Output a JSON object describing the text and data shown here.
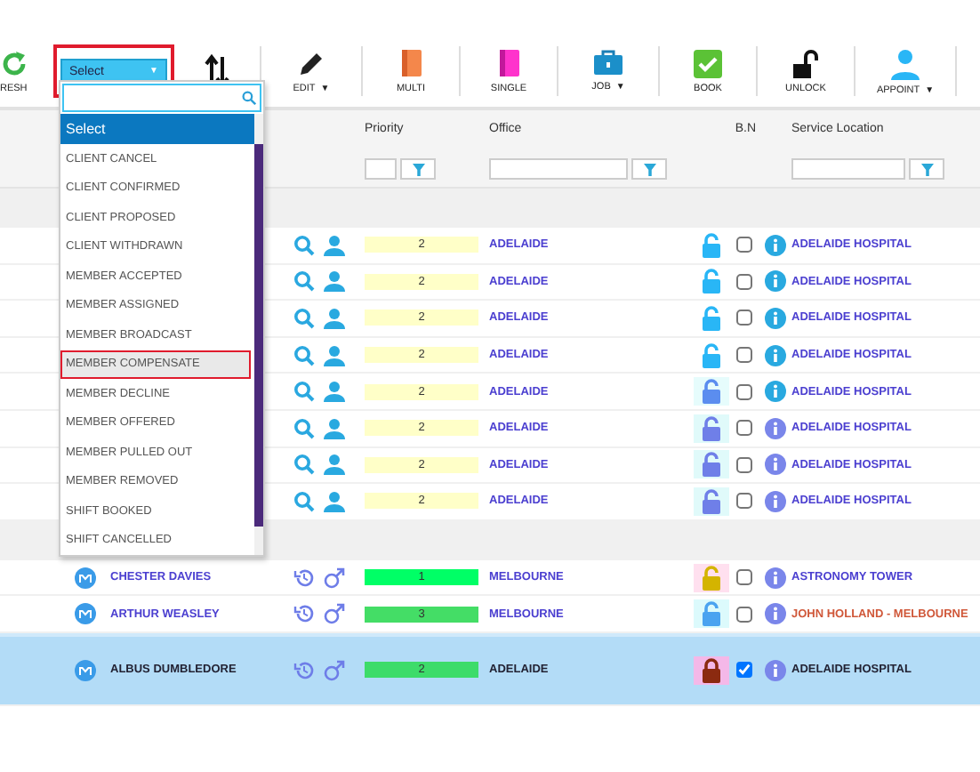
{
  "toolbar": {
    "buttons": [
      {
        "kind": "refresh",
        "label": "RESH"
      },
      {
        "kind": "select",
        "label": "Select",
        "caret": "▼",
        "highlighted": true
      },
      {
        "kind": "sort"
      },
      {
        "kind": "edit",
        "label": "EDIT",
        "caret": "▼"
      },
      {
        "kind": "multi",
        "label": "MULTI"
      },
      {
        "kind": "single",
        "label": "SINGLE"
      },
      {
        "kind": "job",
        "label": "JOB",
        "caret": "▼"
      },
      {
        "kind": "book",
        "label": "BOOK"
      },
      {
        "kind": "unlock",
        "label": "UNLOCK"
      },
      {
        "kind": "appoint",
        "label": "APPOINT",
        "caret": "▼"
      }
    ]
  },
  "dropdown": {
    "open": true,
    "options": [
      {
        "label": "Select",
        "selected": true,
        "hovered": false,
        "highlighted": false
      },
      {
        "label": "CLIENT CANCEL",
        "selected": false,
        "hovered": false,
        "highlighted": false
      },
      {
        "label": "CLIENT CONFIRMED",
        "selected": false,
        "hovered": false,
        "highlighted": false
      },
      {
        "label": "CLIENT PROPOSED",
        "selected": false,
        "hovered": false,
        "highlighted": false
      },
      {
        "label": "CLIENT WITHDRAWN",
        "selected": false,
        "hovered": false,
        "highlighted": false
      },
      {
        "label": "MEMBER ACCEPTED",
        "selected": false,
        "hovered": false,
        "highlighted": false
      },
      {
        "label": "MEMBER ASSIGNED",
        "selected": false,
        "hovered": false,
        "highlighted": false
      },
      {
        "label": "MEMBER BROADCAST",
        "selected": false,
        "hovered": false,
        "highlighted": false
      },
      {
        "label": "MEMBER COMPENSATE",
        "selected": false,
        "hovered": true,
        "highlighted": true
      },
      {
        "label": "MEMBER DECLINE",
        "selected": false,
        "hovered": false,
        "highlighted": false
      },
      {
        "label": "MEMBER OFFERED",
        "selected": false,
        "hovered": false,
        "highlighted": false
      },
      {
        "label": "MEMBER PULLED OUT",
        "selected": false,
        "hovered": false,
        "highlighted": false
      },
      {
        "label": "MEMBER REMOVED",
        "selected": false,
        "hovered": false,
        "highlighted": false
      },
      {
        "label": "SHIFT BOOKED",
        "selected": false,
        "hovered": false,
        "highlighted": false
      },
      {
        "label": "SHIFT CANCELLED",
        "selected": false,
        "hovered": false,
        "highlighted": false
      }
    ]
  },
  "table": {
    "columns": [
      {
        "label": "Priority",
        "filter": true
      },
      {
        "label": "Office",
        "filter": true
      },
      {
        "label": "B.N",
        "filter": false
      },
      {
        "label": "Service Location",
        "filter": true
      }
    ],
    "groups": [
      {
        "rows": [
          {
            "kind": "job",
            "priority": {
              "text": "2",
              "color": "#ffffc8"
            },
            "office": "ADELAIDE",
            "lock_cell": {
              "color": "#ffffff"
            },
            "lock": {
              "locked": false,
              "color": "#29b6f6"
            },
            "checked": false,
            "location": {
              "text": "ADELAIDE HOSPITAL",
              "color": "#4b3fd0"
            },
            "selected": false
          },
          {
            "kind": "job",
            "priority": {
              "text": "2",
              "color": "#ffffc8"
            },
            "office": "ADELAIDE",
            "lock_cell": {
              "color": "#ffffff"
            },
            "lock": {
              "locked": false,
              "color": "#29b6f6"
            },
            "checked": false,
            "location": {
              "text": "ADELAIDE HOSPITAL",
              "color": "#4b3fd0"
            },
            "selected": false
          },
          {
            "kind": "job",
            "priority": {
              "text": "2",
              "color": "#ffffc8"
            },
            "office": "ADELAIDE",
            "lock_cell": {
              "color": "#ffffff"
            },
            "lock": {
              "locked": false,
              "color": "#29b6f6"
            },
            "checked": false,
            "location": {
              "text": "ADELAIDE HOSPITAL",
              "color": "#4b3fd0"
            },
            "selected": false
          },
          {
            "kind": "job",
            "priority": {
              "text": "2",
              "color": "#ffffc8"
            },
            "office": "ADELAIDE",
            "lock_cell": {
              "color": "#ffffff"
            },
            "lock": {
              "locked": false,
              "color": "#29b6f6"
            },
            "checked": false,
            "location": {
              "text": "ADELAIDE HOSPITAL",
              "color": "#4b3fd0"
            },
            "selected": false
          },
          {
            "kind": "job",
            "priority": {
              "text": "2",
              "color": "#ffffc8"
            },
            "office": "ADELAIDE",
            "lock_cell": {
              "color": "#e6fcfc"
            },
            "lock": {
              "locked": false,
              "color": "#5b8def"
            },
            "checked": false,
            "location": {
              "text": "ADELAIDE HOSPITAL",
              "color": "#4b3fd0"
            },
            "selected": false
          },
          {
            "kind": "job",
            "priority": {
              "text": "2",
              "color": "#ffffc8"
            },
            "office": "ADELAIDE",
            "lock_cell": {
              "color": "#e0fafa"
            },
            "lock": {
              "locked": false,
              "color": "#6f7fe8"
            },
            "checked": false,
            "location": {
              "text": "ADELAIDE HOSPITAL",
              "color": "#4b3fd0"
            },
            "selected": false
          },
          {
            "kind": "job",
            "priority": {
              "text": "2",
              "color": "#ffffc8"
            },
            "office": "ADELAIDE",
            "lock_cell": {
              "color": "#e0fafa"
            },
            "lock": {
              "locked": false,
              "color": "#6f7fe8"
            },
            "checked": false,
            "location": {
              "text": "ADELAIDE HOSPITAL",
              "color": "#4b3fd0"
            },
            "selected": false
          },
          {
            "kind": "job",
            "priority": {
              "text": "2",
              "color": "#ffffc8"
            },
            "office": "ADELAIDE",
            "lock_cell": {
              "color": "#e0fafa"
            },
            "lock": {
              "locked": false,
              "color": "#6f7fe8"
            },
            "checked": false,
            "location": {
              "text": "ADELAIDE HOSPITAL",
              "color": "#4b3fd0"
            },
            "selected": false
          }
        ]
      },
      {
        "rows": [
          {
            "kind": "member",
            "name": "CHESTER DAVIES",
            "priority": {
              "text": "1",
              "color": "#00ff66"
            },
            "office": "MELBOURNE",
            "lock_cell": {
              "color": "#ffe0ef"
            },
            "lock": {
              "locked": false,
              "color": "#d4b400"
            },
            "checked": false,
            "location": {
              "text": "ASTRONOMY TOWER",
              "color": "#4b3fd0"
            },
            "selected": false
          },
          {
            "kind": "member",
            "name": "ARTHUR WEASLEY",
            "priority": {
              "text": "3",
              "color": "#44dd66"
            },
            "office": "MELBOURNE",
            "lock_cell": {
              "color": "#dcfafc"
            },
            "lock": {
              "locked": false,
              "color": "#4aa3f0"
            },
            "checked": false,
            "location": {
              "text": "JOHN HOLLAND - MELBOURNE",
              "color": "#d0583a"
            },
            "selected": false
          },
          {
            "kind": "member",
            "name": "ALBUS DUMBLEDORE",
            "priority": {
              "text": "2",
              "color": "#3ddc6a"
            },
            "office": "ADELAIDE",
            "lock_cell": {
              "color": "#f4b8e8"
            },
            "lock": {
              "locked": true,
              "color": "#8b2a10"
            },
            "checked": true,
            "location": {
              "text": "ADELAIDE HOSPITAL",
              "color": "#222233"
            },
            "selected": true
          }
        ]
      }
    ]
  }
}
